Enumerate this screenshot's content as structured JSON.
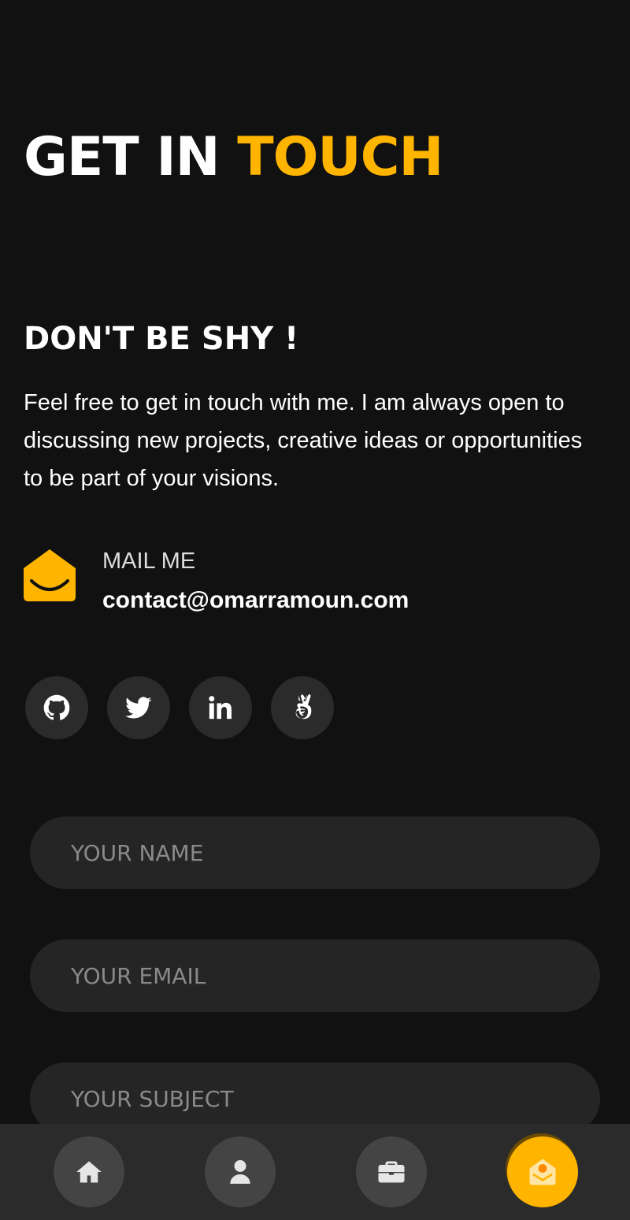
{
  "header": {
    "title_part1": "GET IN ",
    "title_part2": "TOUCH"
  },
  "intro": {
    "heading": "DON'T BE SHY !",
    "text": "Feel free to get in touch with me. I am always open to discussing new projects, creative ideas or opportunities to be part of your visions."
  },
  "contact": {
    "mail_label": "MAIL ME",
    "mail_value": "contact@omarramoun.com"
  },
  "socials": [
    {
      "name": "github-icon"
    },
    {
      "name": "twitter-icon"
    },
    {
      "name": "linkedin-icon"
    },
    {
      "name": "angellist-icon"
    }
  ],
  "form": {
    "name_placeholder": "YOUR NAME",
    "email_placeholder": "YOUR EMAIL",
    "subject_placeholder": "YOUR SUBJECT"
  },
  "nav": {
    "items": [
      {
        "icon": "home-icon"
      },
      {
        "icon": "user-icon"
      },
      {
        "icon": "briefcase-icon"
      },
      {
        "icon": "envelope-open-icon",
        "active": true
      }
    ]
  },
  "colors": {
    "accent": "#ffb400",
    "background": "#111111",
    "surface": "#252525"
  }
}
